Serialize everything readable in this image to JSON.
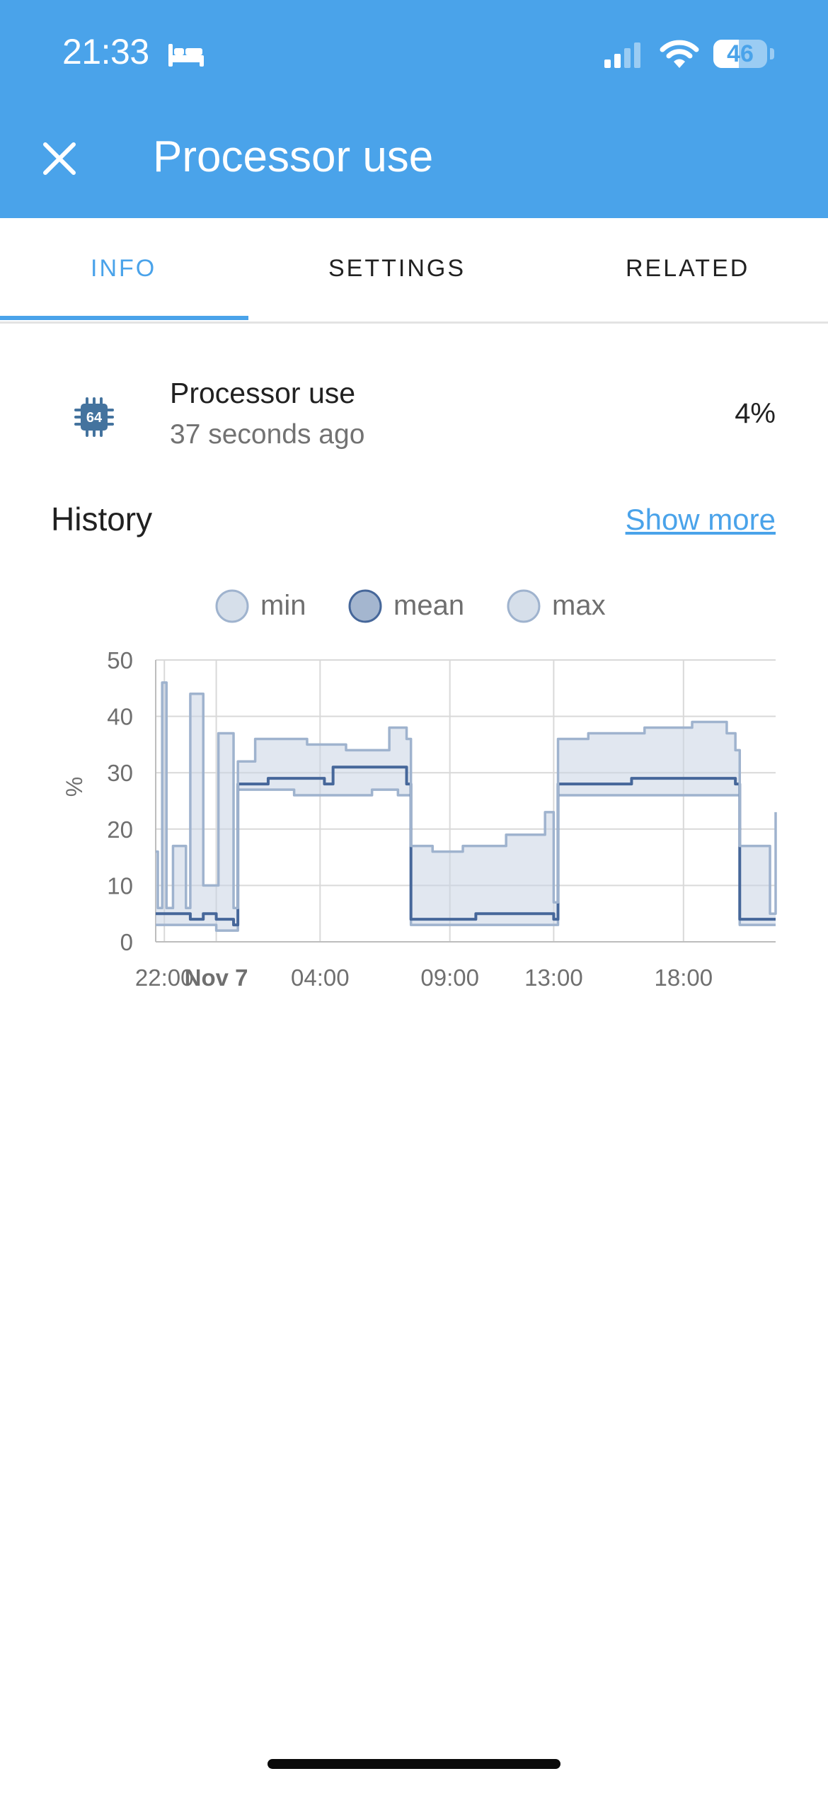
{
  "status_bar": {
    "time": "21:33",
    "battery": "46"
  },
  "header": {
    "title": "Processor use"
  },
  "tabs": [
    {
      "label": "INFO",
      "active": true
    },
    {
      "label": "SETTINGS",
      "active": false
    },
    {
      "label": "RELATED",
      "active": false
    }
  ],
  "entity": {
    "icon": "cpu-64-bit-icon",
    "name": "Processor use",
    "last_changed": "37 seconds ago",
    "state": "4%"
  },
  "history": {
    "title": "History",
    "show_more_label": "Show more"
  },
  "colors": {
    "accent": "#4aa3ea",
    "mean_line": "#46679a",
    "min_max_line": "#9fb3ce",
    "band_fill": "#c8d4e4"
  },
  "chart_data": {
    "type": "line",
    "ylabel": "%",
    "ylim": [
      0,
      50
    ],
    "yticks": [
      0,
      10,
      20,
      30,
      40,
      50
    ],
    "xlim": [
      "2023-11-06 21:40",
      "2023-11-07 21:33"
    ],
    "xticks": [
      {
        "label": "22:00",
        "x": "2023-11-06 22:00",
        "bold": false
      },
      {
        "label": "Nov 7",
        "x": "2023-11-07 00:00",
        "bold": true
      },
      {
        "label": "04:00",
        "x": "2023-11-07 04:00",
        "bold": false
      },
      {
        "label": "09:00",
        "x": "2023-11-07 09:00",
        "bold": false
      },
      {
        "label": "13:00",
        "x": "2023-11-07 13:00",
        "bold": false
      },
      {
        "label": "18:00",
        "x": "2023-11-07 18:00",
        "bold": false
      }
    ],
    "grid": true,
    "legend_position": "top",
    "series": [
      {
        "name": "min",
        "x": [
          "2023-11-06 21:40",
          "2023-11-06 23:50",
          "2023-11-07 00:00",
          "2023-11-07 00:40",
          "2023-11-07 00:50",
          "2023-11-07 03:00",
          "2023-11-07 06:00",
          "2023-11-07 07:00",
          "2023-11-07 07:20",
          "2023-11-07 07:30",
          "2023-11-07 10:00",
          "2023-11-07 13:00",
          "2023-11-07 13:10",
          "2023-11-07 16:00",
          "2023-11-07 20:00",
          "2023-11-07 20:10",
          "2023-11-07 21:33"
        ],
        "values": [
          3,
          3,
          2,
          2,
          27,
          26,
          27,
          26,
          26,
          3,
          3,
          3,
          26,
          26,
          26,
          3,
          3
        ]
      },
      {
        "name": "mean",
        "x": [
          "2023-11-06 21:40",
          "2023-11-06 22:10",
          "2023-11-06 23:00",
          "2023-11-06 23:30",
          "2023-11-07 00:00",
          "2023-11-07 00:40",
          "2023-11-07 00:50",
          "2023-11-07 02:00",
          "2023-11-07 04:10",
          "2023-11-07 04:30",
          "2023-11-07 07:20",
          "2023-11-07 07:30",
          "2023-11-07 10:00",
          "2023-11-07 13:00",
          "2023-11-07 13:10",
          "2023-11-07 16:00",
          "2023-11-07 20:00",
          "2023-11-07 20:10",
          "2023-11-07 21:33"
        ],
        "values": [
          5,
          5,
          4,
          5,
          4,
          3,
          28,
          29,
          28,
          31,
          28,
          4,
          5,
          4,
          28,
          29,
          28,
          4,
          4
        ]
      },
      {
        "name": "max",
        "x": [
          "2023-11-06 21:40",
          "2023-11-06 21:45",
          "2023-11-06 21:55",
          "2023-11-06 22:05",
          "2023-11-06 22:20",
          "2023-11-06 22:50",
          "2023-11-06 23:00",
          "2023-11-06 23:30",
          "2023-11-07 00:05",
          "2023-11-07 00:40",
          "2023-11-07 00:50",
          "2023-11-07 01:30",
          "2023-11-07 03:30",
          "2023-11-07 05:00",
          "2023-11-07 06:40",
          "2023-11-07 07:20",
          "2023-11-07 07:30",
          "2023-11-07 08:20",
          "2023-11-07 09:30",
          "2023-11-07 11:10",
          "2023-11-07 12:40",
          "2023-11-07 13:00",
          "2023-11-07 13:10",
          "2023-11-07 14:20",
          "2023-11-07 16:30",
          "2023-11-07 18:20",
          "2023-11-07 19:40",
          "2023-11-07 20:00",
          "2023-11-07 20:10",
          "2023-11-07 21:20",
          "2023-11-07 21:33"
        ],
        "values": [
          16,
          6,
          46,
          6,
          17,
          6,
          44,
          10,
          37,
          6,
          32,
          36,
          35,
          34,
          38,
          36,
          17,
          16,
          17,
          19,
          23,
          7,
          36,
          37,
          38,
          39,
          37,
          34,
          17,
          5,
          23
        ]
      }
    ]
  }
}
